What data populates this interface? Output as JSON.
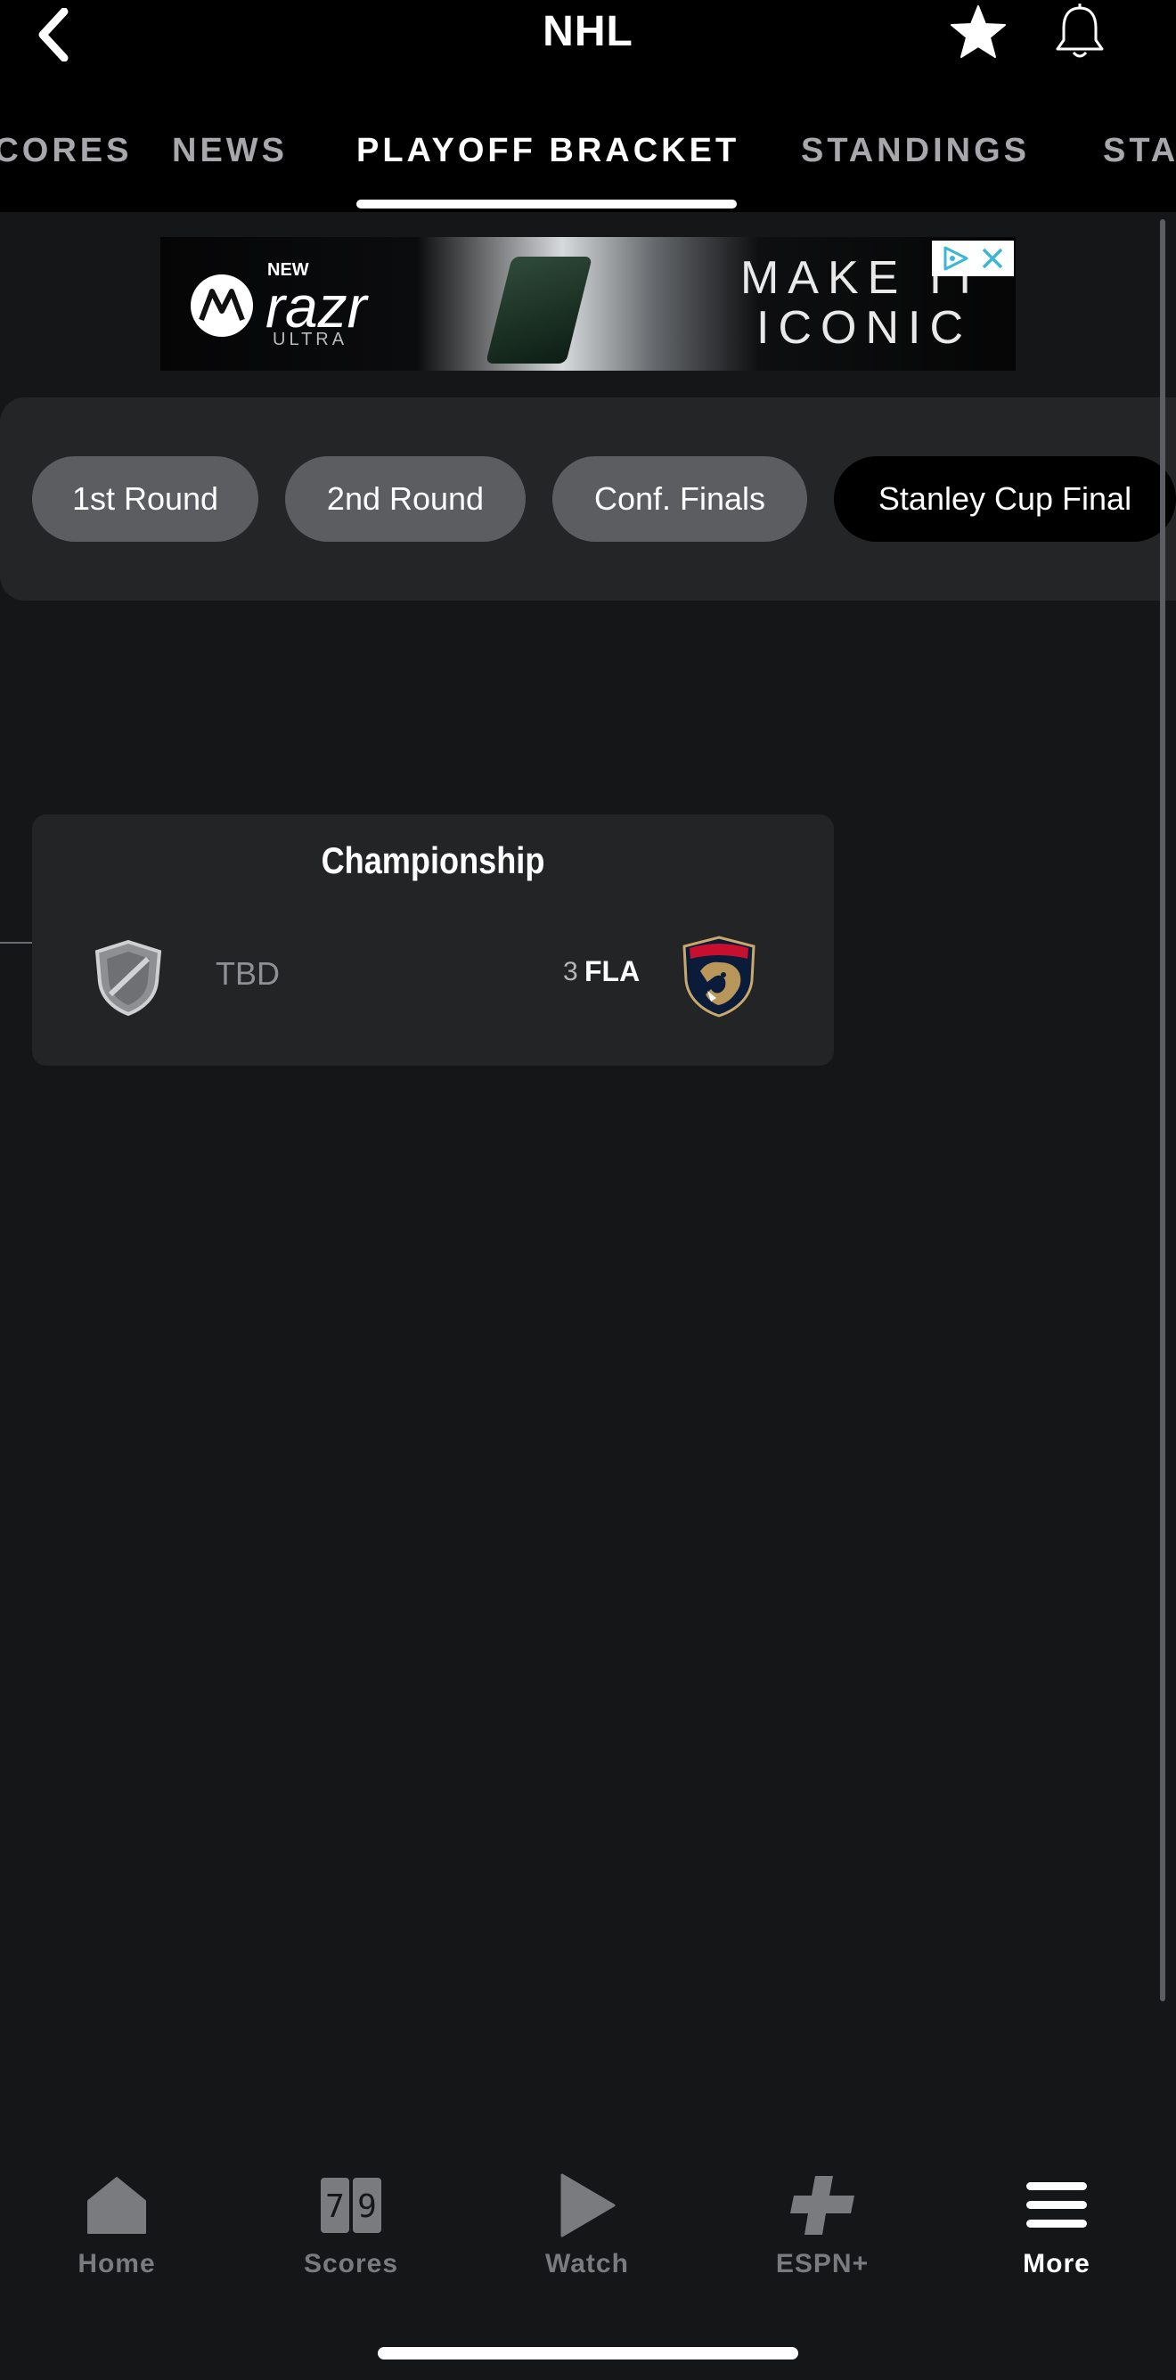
{
  "header": {
    "title": "NHL",
    "tabs": [
      {
        "label": "SCORES"
      },
      {
        "label": "NEWS"
      },
      {
        "label": "PLAYOFF BRACKET"
      },
      {
        "label": "STANDINGS"
      },
      {
        "label": "STATS"
      }
    ],
    "active_tab": "PLAYOFF BRACKET"
  },
  "ad": {
    "new_label": "NEW",
    "brand": "razr",
    "model": "ULTRA",
    "headline_line1": "MAKE IT",
    "headline_line2": "ICONIC"
  },
  "rounds": [
    {
      "label": "1st Round"
    },
    {
      "label": "2nd Round"
    },
    {
      "label": "Conf. Finals"
    },
    {
      "label": "Stanley Cup Final"
    }
  ],
  "active_round": "Stanley Cup Final",
  "matchup": {
    "title": "Championship",
    "team_left": {
      "name": "TBD"
    },
    "team_right": {
      "seed": "3",
      "abbr": "FLA"
    }
  },
  "bottom_nav": [
    {
      "label": "Home"
    },
    {
      "label": "Scores"
    },
    {
      "label": "Watch"
    },
    {
      "label": "ESPN+"
    },
    {
      "label": "More"
    }
  ],
  "active_nav": "More",
  "colors": {
    "background": "#151618",
    "header": "#000000",
    "pill": "#5c5d60",
    "pill_active": "#000000",
    "card": "#232426"
  }
}
